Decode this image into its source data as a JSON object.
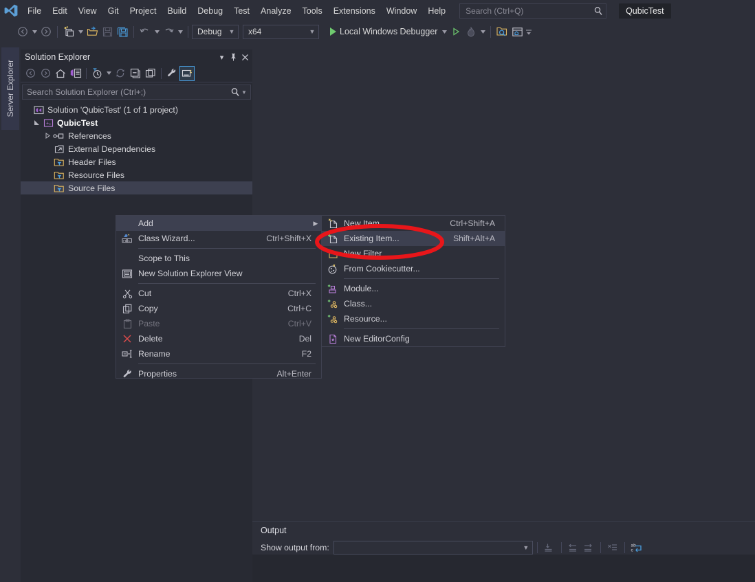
{
  "app": {
    "title": "Visual Studio",
    "project_chip": "QubicTest"
  },
  "menubar": {
    "items": [
      "File",
      "Edit",
      "View",
      "Git",
      "Project",
      "Build",
      "Debug",
      "Test",
      "Analyze",
      "Tools",
      "Extensions",
      "Window",
      "Help"
    ],
    "search_placeholder": "Search (Ctrl+Q)"
  },
  "toolbar": {
    "configuration": "Debug",
    "platform": "x64",
    "run_label": "Local Windows Debugger"
  },
  "dockstrip": {
    "server_explorer": "Server Explorer"
  },
  "solution_explorer": {
    "title": "Solution Explorer",
    "search_placeholder": "Search Solution Explorer (Ctrl+;)",
    "tree": [
      {
        "label": "Solution 'QubicTest' (1 of 1 project)",
        "indent": 0,
        "icon": "solution-icon",
        "bold": false,
        "selected": false,
        "arrow": ""
      },
      {
        "label": "QubicTest",
        "indent": 1,
        "icon": "cpp-project-icon",
        "bold": true,
        "selected": false,
        "arrow": "expanded"
      },
      {
        "label": "References",
        "indent": 2,
        "icon": "references-icon",
        "bold": false,
        "selected": false,
        "arrow": "collapsed"
      },
      {
        "label": "External Dependencies",
        "indent": 2,
        "icon": "external-dependencies-icon",
        "bold": false,
        "selected": false,
        "arrow": ""
      },
      {
        "label": "Header Files",
        "indent": 2,
        "icon": "filter-folder-icon",
        "bold": false,
        "selected": false,
        "arrow": ""
      },
      {
        "label": "Resource Files",
        "indent": 2,
        "icon": "filter-folder-icon",
        "bold": false,
        "selected": false,
        "arrow": ""
      },
      {
        "label": "Source Files",
        "indent": 2,
        "icon": "filter-folder-icon",
        "bold": false,
        "selected": true,
        "arrow": ""
      }
    ]
  },
  "context_menu": {
    "items": [
      {
        "label": "Add",
        "shortcut": "",
        "icon": "",
        "submenu": true,
        "highlighted": true,
        "disabled": false
      },
      {
        "label": "Class Wizard...",
        "shortcut": "Ctrl+Shift+X",
        "icon": "class-wizard-icon",
        "submenu": false,
        "highlighted": false,
        "disabled": false
      },
      {
        "divider": true
      },
      {
        "label": "Scope to This",
        "shortcut": "",
        "icon": "",
        "submenu": false,
        "highlighted": false,
        "disabled": false
      },
      {
        "label": "New Solution Explorer View",
        "shortcut": "",
        "icon": "new-view-icon",
        "submenu": false,
        "highlighted": false,
        "disabled": false
      },
      {
        "divider": true
      },
      {
        "label": "Cut",
        "shortcut": "Ctrl+X",
        "icon": "scissors-icon",
        "submenu": false,
        "highlighted": false,
        "disabled": false
      },
      {
        "label": "Copy",
        "shortcut": "Ctrl+C",
        "icon": "copy-icon",
        "submenu": false,
        "highlighted": false,
        "disabled": false
      },
      {
        "label": "Paste",
        "shortcut": "Ctrl+V",
        "icon": "paste-icon",
        "submenu": false,
        "highlighted": false,
        "disabled": true
      },
      {
        "label": "Delete",
        "shortcut": "Del",
        "icon": "delete-x-icon",
        "submenu": false,
        "highlighted": false,
        "disabled": false
      },
      {
        "label": "Rename",
        "shortcut": "F2",
        "icon": "rename-icon",
        "submenu": false,
        "highlighted": false,
        "disabled": false
      },
      {
        "divider": true
      },
      {
        "label": "Properties",
        "shortcut": "Alt+Enter",
        "icon": "wrench-icon",
        "submenu": false,
        "highlighted": false,
        "disabled": false
      }
    ]
  },
  "add_submenu": {
    "items": [
      {
        "label": "New Item...",
        "shortcut": "Ctrl+Shift+A",
        "icon": "new-item-icon",
        "highlighted": false
      },
      {
        "label": "Existing Item...",
        "shortcut": "Shift+Alt+A",
        "icon": "existing-item-icon",
        "highlighted": true
      },
      {
        "label": "New Filter",
        "shortcut": "",
        "icon": "new-filter-icon",
        "highlighted": false
      },
      {
        "label": "From Cookiecutter...",
        "shortcut": "",
        "icon": "cookiecutter-icon",
        "highlighted": false
      },
      {
        "divider": true
      },
      {
        "label": "Module...",
        "shortcut": "",
        "icon": "module-icon",
        "highlighted": false
      },
      {
        "label": "Class...",
        "shortcut": "",
        "icon": "class-icon",
        "highlighted": false
      },
      {
        "label": "Resource...",
        "shortcut": "",
        "icon": "resource-icon",
        "highlighted": false
      },
      {
        "divider": true
      },
      {
        "label": "New EditorConfig",
        "shortcut": "",
        "icon": "editorconfig-icon",
        "highlighted": false
      }
    ]
  },
  "output_panel": {
    "title": "Output",
    "show_output_from_label": "Show output from:",
    "show_output_from_value": ""
  },
  "annotation": {
    "shape": "ellipse",
    "color": "#e8161a",
    "target": "Existing Item..."
  },
  "colors": {
    "window_bg": "#2d2f39",
    "panel_bg": "#282a33",
    "menu_bg": "#2d2f39",
    "selection": "#3d4050",
    "accent_blue": "#4a9fe0",
    "annotation_red": "#e8161a",
    "run_green": "#6fca6f"
  }
}
